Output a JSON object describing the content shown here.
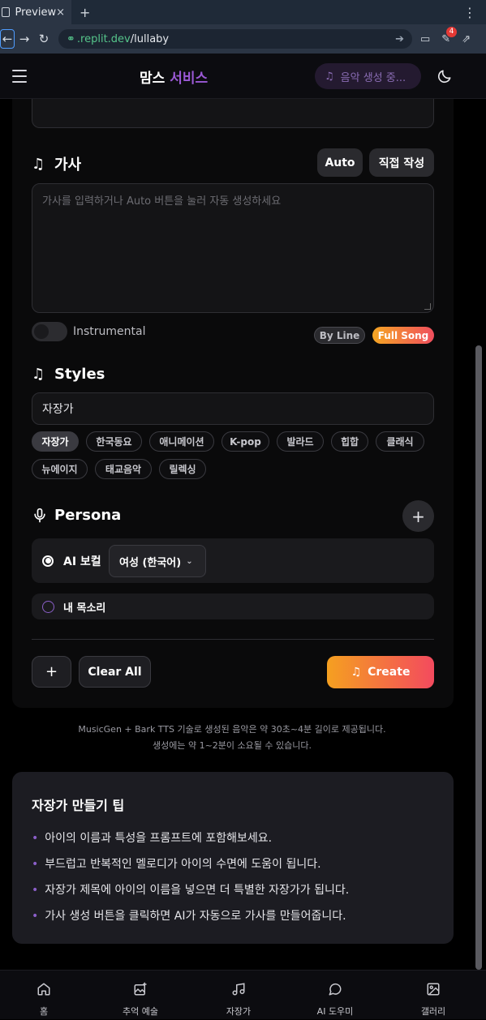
{
  "browser": {
    "tab_title": "Preview",
    "tab_close": "×",
    "new_tab": "+",
    "url_host": ".replit.dev",
    "url_path": "/lullaby",
    "badge_count": "4"
  },
  "header": {
    "logo_part1": "맘스",
    "logo_part2": "서비스",
    "status_pill": "음악 생성 중..."
  },
  "lyrics": {
    "title": "가사",
    "auto_button": "Auto",
    "manual_button": "직접 작성",
    "placeholder": "가사를 입력하거나 Auto 버튼을 눌러 자동 생성하세요",
    "instrumental_label": "Instrumental",
    "by_line": "By Line",
    "full_song": "Full Song"
  },
  "styles": {
    "title": "Styles",
    "value": "자장가",
    "tags": [
      "자장가",
      "한국동요",
      "애니메이션",
      "K-pop",
      "발라드",
      "힙합",
      "클래식",
      "뉴에이지",
      "태교음악",
      "릴렉싱"
    ],
    "active_tag": "자장가"
  },
  "persona": {
    "title": "Persona",
    "add": "+",
    "ai_vocal_label": "AI 보컬",
    "ai_vocal_value": "여성 (한국어)",
    "my_voice_label": "내 목소리"
  },
  "actions": {
    "add": "+",
    "clear_all": "Clear All",
    "create": "Create"
  },
  "footnote": {
    "line1": "MusicGen + Bark TTS 기술로 생성된 음악은 약 30초~4분 길이로 제공됩니다.",
    "line2": "생성에는 약 1~2분이 소요될 수 있습니다."
  },
  "tips": {
    "title": "자장가 만들기 팁",
    "items": [
      "아이의 이름과 특성을 프롬프트에 포함해보세요.",
      "부드럽고 반복적인 멜로디가 아이의 수면에 도움이 됩니다.",
      "자장가 제목에 아이의 이름을 넣으면 더 특별한 자장가가 됩니다.",
      "가사 생성 버튼을 클릭하면 AI가 자동으로 가사를 만들어줍니다."
    ]
  },
  "bottom_nav": [
    {
      "label": "홈",
      "icon": "home-icon"
    },
    {
      "label": "추억 예술",
      "icon": "image-plus-icon"
    },
    {
      "label": "자장가",
      "icon": "music-icon"
    },
    {
      "label": "AI 도우미",
      "icon": "chat-icon"
    },
    {
      "label": "갤러리",
      "icon": "gallery-icon"
    }
  ],
  "colors": {
    "accent_purple": "#9b59d6",
    "gradient_start": "#f5a020",
    "gradient_end": "#f34a5e"
  }
}
